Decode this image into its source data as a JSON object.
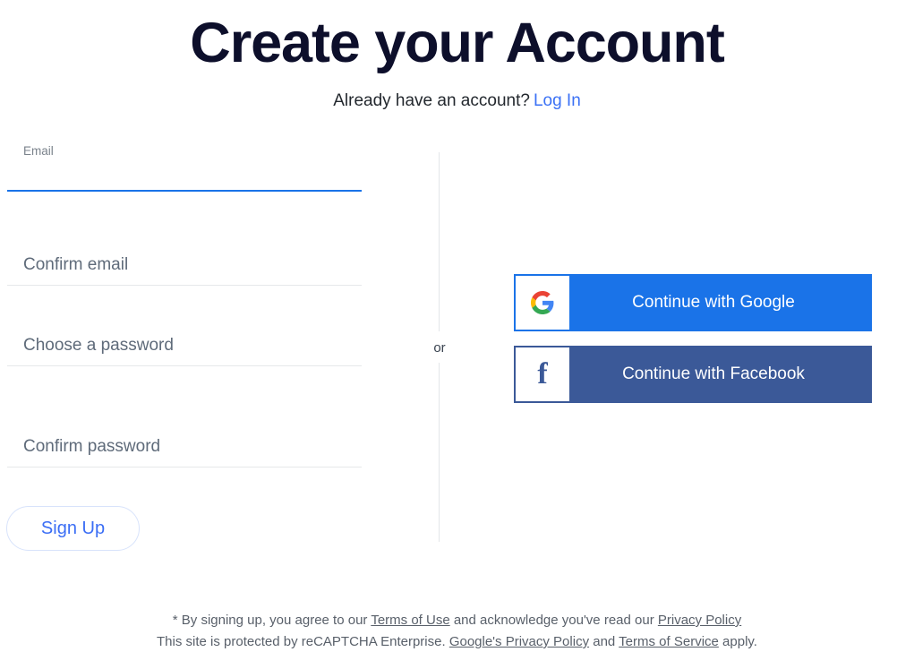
{
  "header": {
    "title": "Create your Account",
    "subtitle_text": "Already have an account?",
    "login_link": "Log In"
  },
  "form": {
    "fields": [
      {
        "name": "email",
        "label": "Email",
        "value": "",
        "state": "focused"
      },
      {
        "name": "confirm_email",
        "label": "Confirm email",
        "value": "",
        "state": "empty"
      },
      {
        "name": "password",
        "label": "Choose a password",
        "value": "",
        "state": "empty"
      },
      {
        "name": "confirm_password",
        "label": "Confirm password",
        "value": "",
        "state": "empty"
      }
    ],
    "submit_label": "Sign Up"
  },
  "divider": {
    "or_label": "or"
  },
  "social": {
    "google": {
      "label": "Continue with Google",
      "icon": "google-g-icon",
      "color": "#1a73e8"
    },
    "facebook": {
      "label": "Continue with Facebook",
      "icon": "facebook-f-icon",
      "glyph": "f",
      "color": "#3b5998"
    }
  },
  "footer": {
    "line1_prefix": "* By signing up, you agree to our ",
    "terms_of_use": "Terms of Use",
    "line1_middle": " and acknowledge you've read our ",
    "privacy_policy": "Privacy Policy",
    "line2_prefix": "This site is protected by reCAPTCHA Enterprise. ",
    "google_privacy_policy": "Google's Privacy Policy",
    "line2_middle": " and ",
    "terms_of_service": "Terms of Service",
    "line2_suffix": " apply."
  },
  "colors": {
    "title": "#0d0f2b",
    "link_blue": "#3b71f5",
    "focus_underline": "#1a73e8",
    "google_blue": "#1a73e8",
    "facebook_blue": "#3b5998"
  }
}
